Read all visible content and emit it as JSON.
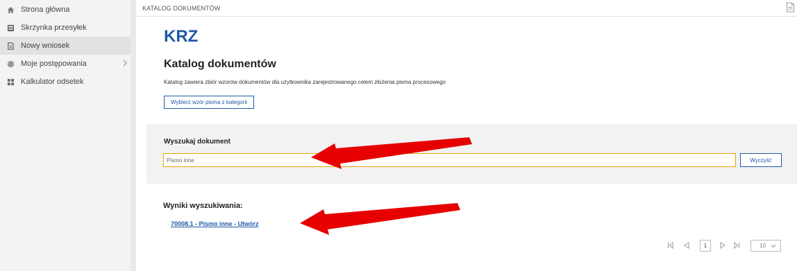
{
  "sidebar": {
    "items": [
      {
        "label": "Strona główna",
        "icon": "home-icon"
      },
      {
        "label": "Skrzynka przesyłek",
        "icon": "inbox-icon"
      },
      {
        "label": "Nowy wniosek",
        "icon": "document-icon",
        "active": true
      },
      {
        "label": "Moje postępowania",
        "icon": "gear-icon",
        "has_submenu": true
      },
      {
        "label": "Kalkulator odsetek",
        "icon": "calculator-icon"
      }
    ]
  },
  "header": {
    "breadcrumb": "KATALOG DOKUMENTÓW",
    "doc_icon": "document-icon"
  },
  "main": {
    "title": "KRZ",
    "heading": "Katalog dokumentów",
    "description": "Katalog zawiera zbiór wzorów dokumentów dla użytkownika zarejestrowanego celem złożenia pisma procesowego",
    "category_button_label": "Wybierz wzór pisma z kategorii"
  },
  "search": {
    "label": "Wyszukaj dokument",
    "value": "Pismo inne",
    "clear_button_label": "Wyczyść"
  },
  "results": {
    "label": "Wyniki wyszukiwania:",
    "items": [
      {
        "text": "70008.1 - Pismo inne - Utwórz"
      }
    ]
  },
  "pagination": {
    "current_page": "1",
    "page_size": "10"
  },
  "colors": {
    "accent": "#1d5aa7",
    "input_focus_border": "#e8a400",
    "arrow": "#e80000"
  }
}
